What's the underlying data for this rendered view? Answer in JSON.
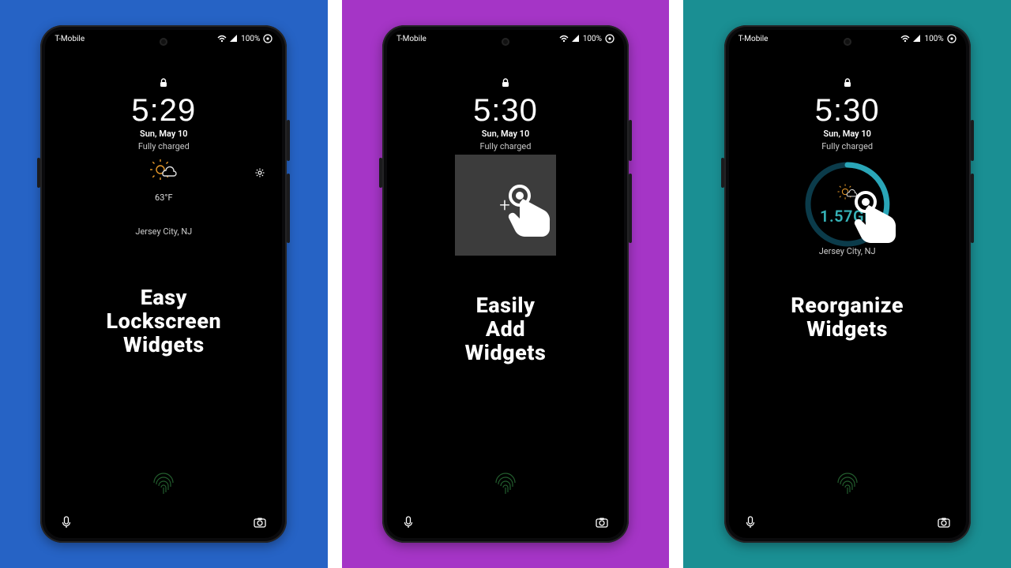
{
  "status": {
    "carrier": "T-Mobile",
    "battery_text": "100%"
  },
  "panels": [
    {
      "bg": "#2663c5",
      "time": "5:29",
      "date": "Sun, May 10",
      "charge": "Fully charged",
      "temperature": "63°F",
      "location": "Jersey City, NJ",
      "headline": "Easy Lockscreen Widgets"
    },
    {
      "bg": "#a535c6",
      "time": "5:30",
      "date": "Sun, May 10",
      "charge": "Fully charged",
      "headline": "Easily Add Widgets"
    },
    {
      "bg": "#1a8f93",
      "time": "5:30",
      "date": "Sun, May 10",
      "charge": "Fully charged",
      "data_value": "1.57GB",
      "location": "Jersey City, NJ",
      "headline": "Reorganize Widgets"
    }
  ]
}
